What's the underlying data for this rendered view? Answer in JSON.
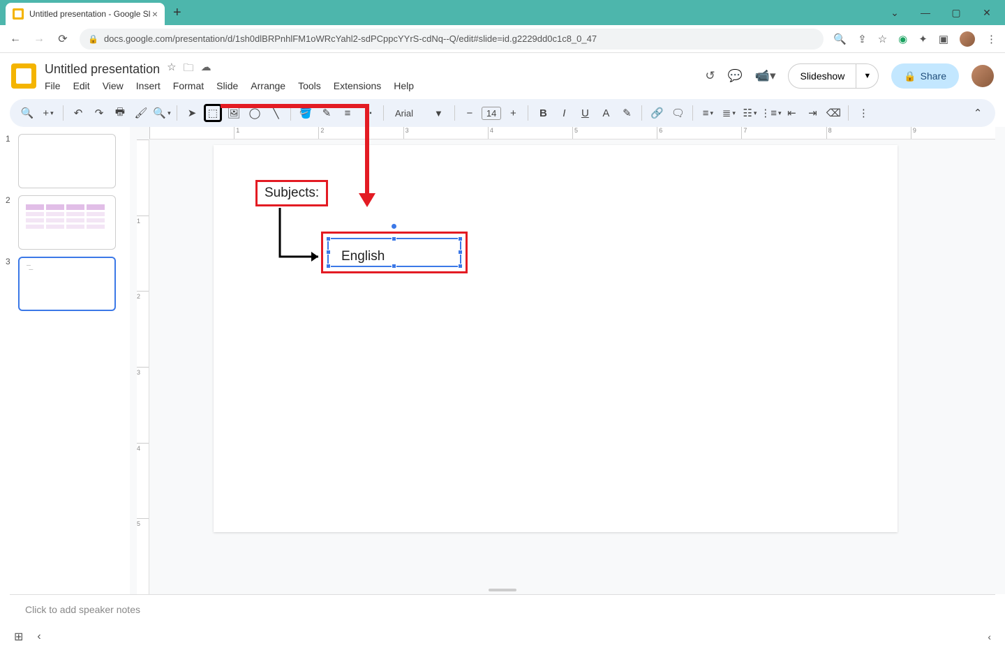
{
  "browser": {
    "tab_title": "Untitled presentation - Google Sl",
    "url": "docs.google.com/presentation/d/1sh0dlBRPnhlFM1oWRcYahl2-sdPCppcYYrS-cdNq--Q/edit#slide=id.g2229dd0c1c8_0_47"
  },
  "header": {
    "doc_title": "Untitled presentation",
    "menu": {
      "file": "File",
      "edit": "Edit",
      "view": "View",
      "insert": "Insert",
      "format": "Format",
      "slide": "Slide",
      "arrange": "Arrange",
      "tools": "Tools",
      "extensions": "Extensions",
      "help": "Help"
    },
    "slideshow": "Slideshow",
    "share": "Share"
  },
  "toolbar": {
    "font_name": "Arial",
    "font_size": "14"
  },
  "filmstrip": {
    "s1": "1",
    "s2": "2",
    "s3": "3"
  },
  "canvas": {
    "subjects_label": "Subjects:",
    "english_label": "English"
  },
  "notes": {
    "placeholder": "Click to add speaker notes"
  }
}
